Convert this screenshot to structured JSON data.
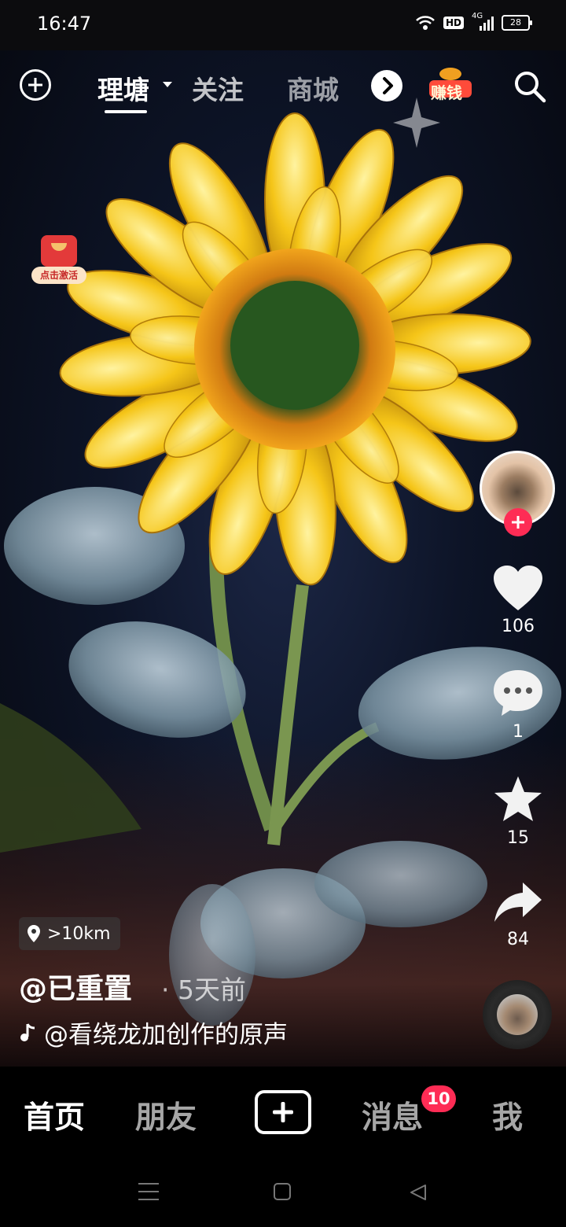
{
  "status_bar": {
    "time": "16:47",
    "network": "4G",
    "hd_label": "HD",
    "battery": "28"
  },
  "top_nav": {
    "tabs": [
      {
        "label": "理塘"
      },
      {
        "label": "关注"
      },
      {
        "label": "商城"
      }
    ],
    "earn_label": "赚钱"
  },
  "promo": {
    "label": "点击激活"
  },
  "actions": {
    "likes": "106",
    "comments": "1",
    "favorites": "15",
    "shares": "84"
  },
  "video_info": {
    "location": ">10km",
    "author": "@已重置",
    "time_ago": "· 5天前",
    "music": "@看绕龙加创作的原声"
  },
  "bottom_nav": {
    "items": [
      {
        "label": "首页"
      },
      {
        "label": "朋友"
      },
      {
        "label": "消息"
      },
      {
        "label": "我"
      }
    ],
    "message_badge": "10"
  },
  "colors": {
    "accent": "#fe2c55",
    "background": "#000000"
  }
}
